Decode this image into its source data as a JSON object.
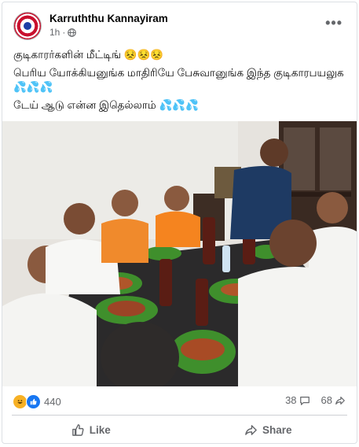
{
  "post": {
    "author": "Karruththu Kannayiram",
    "time": "1h",
    "separator": "·",
    "more": "•••",
    "lines": [
      "குடிகாரர்களின் மீட்டிங் 😣😣😣",
      "பெரிய யோக்கியனுங்க மாதிரியே பேசுவானுங்க இந்த குடிகாரபயலுக 💦💦💦",
      "டேய் ஆடு என்ன இதெல்லாம் 💦💦💦"
    ]
  },
  "stats": {
    "reactions": "440",
    "comments": "38",
    "shares": "68"
  },
  "actions": {
    "like": "Like",
    "share": "Share"
  },
  "colors": {
    "brand_blue": "#1877f2",
    "text_secondary": "#65676b"
  }
}
